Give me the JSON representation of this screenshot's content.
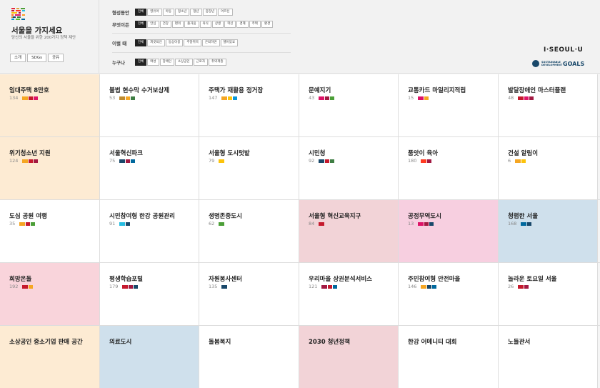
{
  "brand": {
    "title": "서울을 가지세요",
    "subtitle": "당신의 서울을 위한 200가지 정책 제안",
    "tabs": [
      "소개",
      "SDGs",
      "공유"
    ],
    "logo_colors": [
      "#e5243b",
      "#dda63a",
      "#4c9f38",
      "#c5192d",
      "#ff3a21",
      "#26bde2",
      "#fcc30b",
      "#a21942",
      "#fd6925",
      "#dd1367",
      "#fd9d24",
      "#bf8b2e",
      "#3f7e44",
      "#0a97d9",
      "#56c02b",
      "#00689d",
      "#19486a"
    ]
  },
  "filters": [
    {
      "label": "형성동안",
      "chips": [
        "전체",
        "영유아",
        "아동",
        "청소년",
        "청년",
        "중장년",
        "어르신"
      ]
    },
    {
      "label": "무엇이든",
      "chips": [
        "전체",
        "안심",
        "건강",
        "편의",
        "즐거움",
        "육식",
        "상생",
        "혁신",
        "경제",
        "주택",
        "환경"
      ]
    },
    {
      "label": "이럴 때",
      "chips": [
        "전체",
        "피갖퇴인",
        "동상이몽",
        "주말취목",
        "은퇴하면",
        "헬어있요"
      ]
    },
    {
      "label": "누구나",
      "chips": [
        "전체",
        "여성",
        "장애인",
        "소상공인",
        "근로자",
        "취약계층"
      ]
    }
  ],
  "right": {
    "iseoul": "I·SEOUL·U",
    "sdg_small": "SUSTAINABLE DEVELOPMENT",
    "sdg_goals": "GOALS"
  },
  "colors": {
    "orange": "#f5a623",
    "red": "#c5192d",
    "crimson": "#a21942",
    "pink": "#dd1367",
    "green": "#4c9f38",
    "darkgreen": "#3f7e44",
    "navy": "#19486a",
    "blue": "#00689d",
    "lightblue": "#26bde2",
    "gold": "#bf8b2e",
    "yellow": "#fcc30b",
    "teal": "#0a97d9",
    "scarlet": "#ff3a21"
  },
  "cards": [
    {
      "title": "임대주택 8만호",
      "count": "134",
      "bg": "#fdebd3",
      "tags": [
        "#f5a623",
        "#c5192d",
        "#dd1367"
      ]
    },
    {
      "title": "불법 현수막 수거보상제",
      "count": "53",
      "bg": "#ffffff",
      "tags": [
        "#bf8b2e",
        "#f5a623",
        "#3f7e44"
      ]
    },
    {
      "title": "주택가 재활용 정거장",
      "count": "147",
      "bg": "#ffffff",
      "tags": [
        "#f5a623",
        "#fcc30b",
        "#0a97d9"
      ]
    },
    {
      "title": "문예지기",
      "count": "43",
      "bg": "#ffffff",
      "tags": [
        "#dd1367",
        "#a21942",
        "#4c9f38"
      ]
    },
    {
      "title": "교통카드 마일리지적립",
      "count": "15",
      "bg": "#ffffff",
      "tags": [
        "#dd1367",
        "#f5a623"
      ]
    },
    {
      "title": "발달장애인 마스터플랜",
      "count": "48",
      "bg": "#ffffff",
      "tags": [
        "#c5192d",
        "#dd1367",
        "#a21942"
      ]
    },
    {
      "title": "위기청소년 지원",
      "count": "124",
      "bg": "#fdebd3",
      "tags": [
        "#f5a623",
        "#c5192d",
        "#a21942"
      ]
    },
    {
      "title": "서울혁신파크",
      "count": "75",
      "bg": "#ffffff",
      "tags": [
        "#19486a",
        "#a21942",
        "#00689d"
      ]
    },
    {
      "title": "서울형 도시텃밭",
      "count": "79",
      "bg": "#ffffff",
      "tags": [
        "#fcc30b"
      ]
    },
    {
      "title": "시민청",
      "count": "92",
      "bg": "#ffffff",
      "tags": [
        "#19486a",
        "#c5192d",
        "#3f7e44"
      ]
    },
    {
      "title": "품앗이 육아",
      "count": "180",
      "bg": "#ffffff",
      "tags": [
        "#ff3a21",
        "#a21942"
      ]
    },
    {
      "title": "건설 알림이",
      "count": "6",
      "bg": "#ffffff",
      "tags": [
        "#f5a623",
        "#fcc30b"
      ]
    },
    {
      "title": "도심 공원 여행",
      "count": "35",
      "bg": "#ffffff",
      "tags": [
        "#f5a623",
        "#c5192d",
        "#4c9f38"
      ]
    },
    {
      "title": "시민참여형 한강 공원관리",
      "count": "91",
      "bg": "#ffffff",
      "tags": [
        "#26bde2",
        "#19486a"
      ]
    },
    {
      "title": "생명존중도시",
      "count": "62",
      "bg": "#ffffff",
      "tags": [
        "#4c9f38"
      ]
    },
    {
      "title": "서울형 혁신교육지구",
      "count": "84",
      "bg": "#f2d3d7",
      "tags": [
        "#c5192d"
      ]
    },
    {
      "title": "공정무역도시",
      "count": "13",
      "bg": "#f7cfe0",
      "tags": [
        "#dd1367",
        "#a21942",
        "#19486a"
      ]
    },
    {
      "title": "청렴한 서울",
      "count": "168",
      "bg": "#cfe0ec",
      "tags": [
        "#00689d",
        "#19486a"
      ]
    },
    {
      "title": "희망온돌",
      "count": "192",
      "bg": "#f9d4db",
      "tags": [
        "#c5192d",
        "#f5a623"
      ]
    },
    {
      "title": "평생학습포털",
      "count": "179",
      "bg": "#ffffff",
      "tags": [
        "#c5192d",
        "#a21942",
        "#19486a"
      ]
    },
    {
      "title": "자원봉사센터",
      "count": "135",
      "bg": "#ffffff",
      "tags": [
        "#19486a"
      ]
    },
    {
      "title": "우리마을 상권분석서비스",
      "count": "121",
      "bg": "#ffffff",
      "tags": [
        "#a21942",
        "#c5192d",
        "#00689d"
      ]
    },
    {
      "title": "주민참여형 안전마을",
      "count": "146",
      "bg": "#ffffff",
      "tags": [
        "#f5a623",
        "#19486a",
        "#00689d"
      ]
    },
    {
      "title": "놀라운 토요일 서울",
      "count": "26",
      "bg": "#ffffff",
      "tags": [
        "#c5192d",
        "#a21942"
      ]
    },
    {
      "title": "소상공인 중소기업 판매 공간",
      "count": "",
      "bg": "#fdebd3",
      "tags": []
    },
    {
      "title": "의료도시",
      "count": "",
      "bg": "#cfe0ec",
      "tags": []
    },
    {
      "title": "돌봄복지",
      "count": "",
      "bg": "#ffffff",
      "tags": []
    },
    {
      "title": "2030 청년정책",
      "count": "",
      "bg": "#f2d3d7",
      "tags": []
    },
    {
      "title": "한강 어메니티 대회",
      "count": "",
      "bg": "#ffffff",
      "tags": []
    },
    {
      "title": "노들관서",
      "count": "",
      "bg": "#ffffff",
      "tags": []
    }
  ]
}
